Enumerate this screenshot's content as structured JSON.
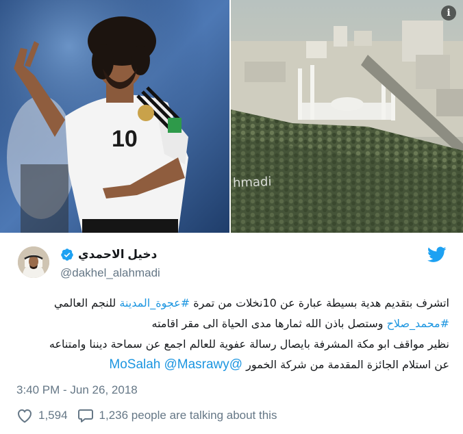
{
  "media": {
    "left_photo_desc_icon": "football-player-photo",
    "right_photo_desc_icon": "city-palm-grove-photo",
    "watermark": "hmadi",
    "jersey_number": "10",
    "info_icon_glyph": "i"
  },
  "author": {
    "display_name": "دخيل الاحمدي",
    "handle": "@dakhel_alahmadi",
    "verified": true
  },
  "tweet": {
    "line1_a": "اتشرف بتقديم هدية بسيطة عبارة عن 10نخلات من تمرة ",
    "line1_hashtag": "#عجوة_المدينة",
    "line1_b": " للنجم العالمي",
    "line2_hashtag": "#محمد_صلاح",
    "line2_b": " وستصل باذن الله ثمارها مدى الحياة الى مقر اقامته",
    "line3": "نظير مواقف ابو مكة المشرفة بايصال رسالة عفوية للعالم اجمع عن سماحة ديننا وامتناعه",
    "line4_a": "عن استلام الجائزة المقدمة من شركة الخمور",
    "mention1": "@MoSalah",
    "mention2": "@Masrawy"
  },
  "timestamp": "3:40 PM - Jun 26, 2018",
  "actions": {
    "likes": "1,594",
    "replies_text": "1,236 people are talking about this"
  },
  "colors": {
    "link": "#1b95e0",
    "secondary_text": "#657786",
    "twitter_blue": "#1da1f2"
  }
}
